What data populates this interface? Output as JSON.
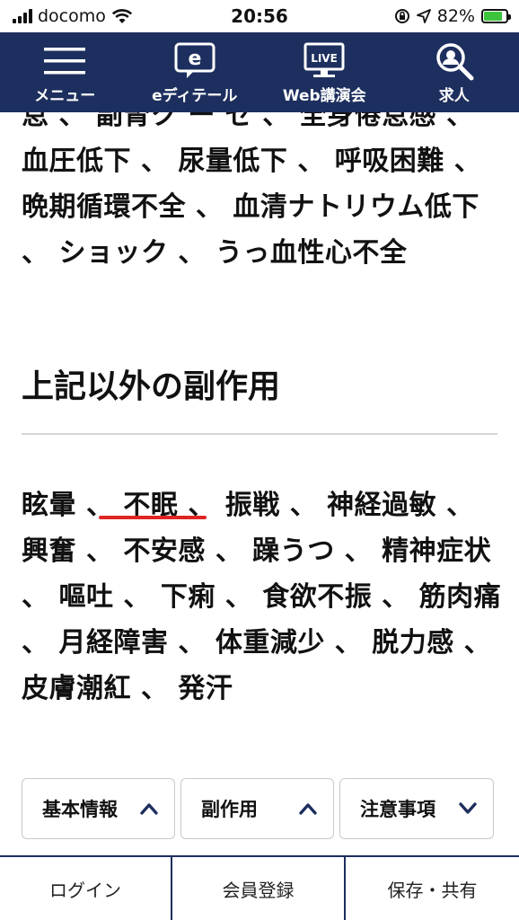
{
  "status_bar": {
    "carrier": "docomo",
    "time": "20:56",
    "battery_percent": "82%",
    "battery_level": 0.82
  },
  "nav": {
    "items": [
      {
        "label": "メニュー",
        "icon": "hamburger-menu-icon"
      },
      {
        "label": "eディテール",
        "icon": "e-detail-chat-icon"
      },
      {
        "label": "Web講演会",
        "icon": "live-monitor-icon",
        "icon_text": "LIVE"
      },
      {
        "label": "求人",
        "icon": "search-icon"
      }
    ]
  },
  "article": {
    "top_paragraph": "怠 、 副腎ク ー ゼ 、 全身倦怠感 、 血圧低下 、 尿量低下 、 呼吸困難 、 晩期循環不全 、 血清ナトリウム低下 、 ショック 、 うっ血性心不全",
    "heading": "上記以外の副作用",
    "side_effects": {
      "before": "眩暈 、 ",
      "underlined": "不眠 、",
      "after": " 振戦 、 神経過敏 、 興奮 、 不安感 、 躁うつ 、 精神症状 、 嘔吐 、 下痢 、 食欲不振 、 筋肉痛 、 月経障害 、 体重減少 、 脱力感 、 皮膚潮紅 、 発汗"
    }
  },
  "tabs": [
    {
      "label": "基本情報",
      "icon": "chevron-up-icon"
    },
    {
      "label": "副作用",
      "icon": "chevron-up-icon"
    },
    {
      "label": "注意事項",
      "icon": "chevron-down-icon"
    }
  ],
  "footer": {
    "login": "ログイン",
    "register": "会員登録",
    "save_share": "保存・共有"
  },
  "colors": {
    "nav_bg": "#1d2f5e",
    "underline": "#e02424",
    "battery": "#3cc43c"
  }
}
